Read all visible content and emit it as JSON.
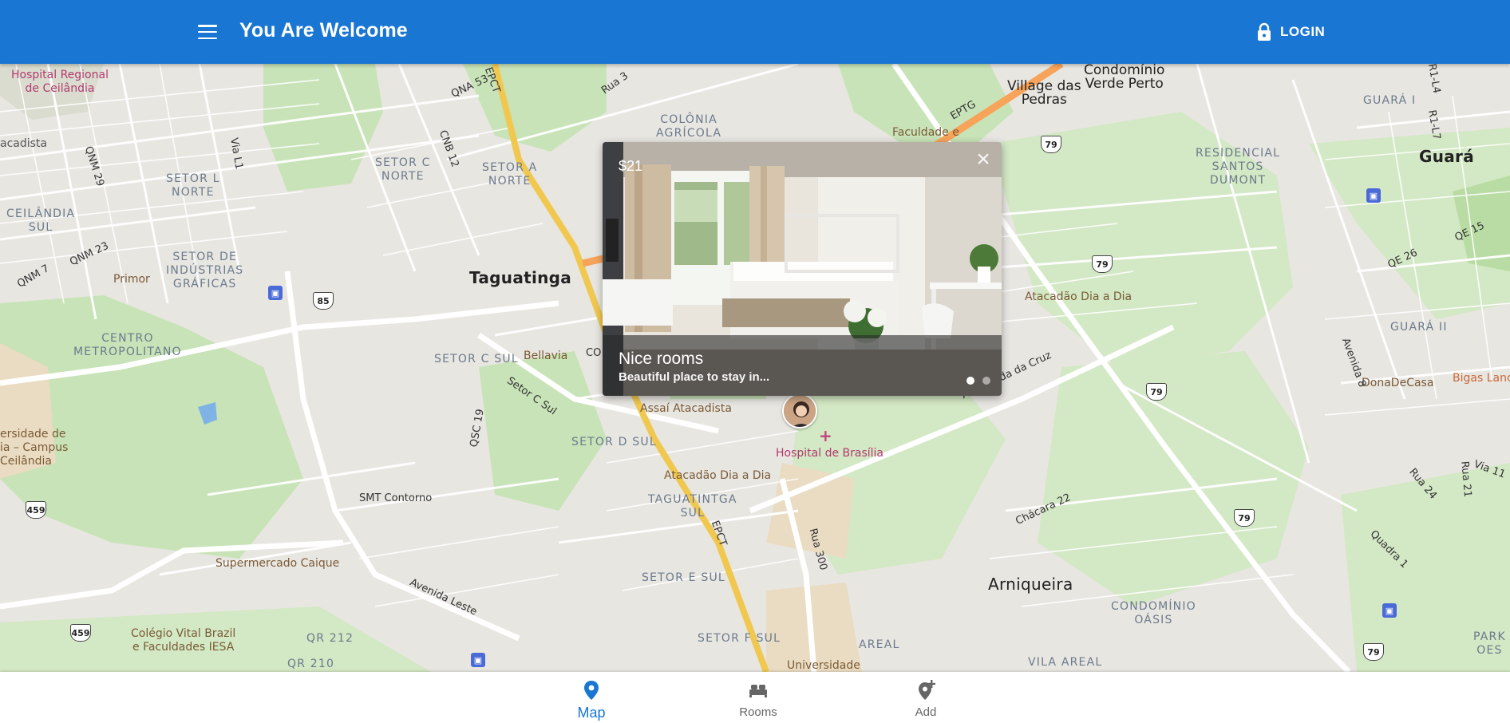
{
  "appbar": {
    "title": "You Are Welcome",
    "login_label": "LOGIN",
    "background": "#1976d2"
  },
  "map": {
    "labels": {
      "hospital_regional": "Hospital Regional\nde Ceilândia",
      "acadista": "acadista",
      "qnm29": "QNM 29",
      "setor_l_norte": "SETOR L\nNORTE",
      "ceilandia_sul": "CEILÂNDIA\nSUL",
      "qnm23": "QNM 23",
      "qnm7": "QNM 7",
      "primor": "Primor",
      "setor_industrias": "SETOR DE\nINDÚSTRIAS\nGRÁFICAS",
      "centro_metro": "CENTRO\nMETROPOLITANO",
      "campus": "ersidade de\nia – Campus\nCeilândia",
      "setor_c_norte": "SETOR C\nNORTE",
      "cnb12": "CNB 12",
      "qna53": "QNA 53",
      "setor_a_norte": "SETOR A\nNORTE",
      "rua3": "Rua 3",
      "colonia": "COLÔNIA\nAGRÍCOLA",
      "faculdade": "Faculdade e",
      "eptg": "EPTG",
      "village": "Village das\nPedras",
      "condominio_vp": "Condomínio\nVerde Perto",
      "guara_i": "GUARÁ I",
      "guara": "Guará",
      "residencial": "RESIDENCIAL\nSANTOS\nDUMONT",
      "qe15": "QE 15",
      "qe26": "QE 26",
      "guara_ii": "GUARÁ II",
      "taguatinga": "Taguatinga",
      "setor_c_sul": "SETOR C SUL",
      "bellavia": "Bellavia",
      "setor_c_sul_road": "Setor C Sul",
      "atacadao1": "Atacadão Dia a Dia",
      "assai": "Assaí Atacadista",
      "hospital_brasilia": "Hospital de Brasília",
      "setor_d_sul": "SETOR D SUL",
      "atacadao2": "Atacadão Dia a Dia",
      "taguatinga_sul": "TAGUATINTGA\nSUL",
      "qsc19": "QSC 19",
      "smt": "SMT Contorno",
      "supermercado": "Supermercado Caique",
      "colegio": "Colégio Vital Brazil\ne Faculdades IESA",
      "avenida_leste": "Avenida Leste",
      "qr212": "QR 212",
      "qr210": "QR 210",
      "setor_e_sul": "SETOR E SUL",
      "setor_f_sul": "SETOR F SUL",
      "universidade": "Universidade",
      "areal": "AREAL",
      "vila_areal": "VILA AREAL",
      "arniqueira": "Arniqueira",
      "condominio_oasis": "CONDOMÍNIO\nOÁSIS",
      "rua300": "Rua 300",
      "chacara22": "Chácara 22",
      "vereda": "Av. Vereda da Cruz",
      "donadecasa": "DonaDeCasa",
      "bigas": "Bigas Lanc",
      "avenida8": "Avenida 8",
      "rua24": "Rua 24",
      "rua21": "Rua 21",
      "via11": "Via 11",
      "quadra1": "Quadra 1",
      "park": "PARK\nOES",
      "atacadao3": "Atacadão Dia a Dia",
      "epct": "EPCT",
      "epct2": "EPCT",
      "via_l1": "Via L1",
      "r1l4": "R1-L4",
      "r1l7": "R1-L7",
      "co": "CO"
    },
    "shields": [
      "85",
      "459",
      "459",
      "79",
      "79",
      "79",
      "79",
      "79"
    ]
  },
  "popup": {
    "price": "$21",
    "title": "Nice rooms",
    "subtitle": "Beautiful place to stay in...",
    "slides": 2,
    "active_slide": 1
  },
  "bottom_nav": {
    "items": [
      {
        "label": "Map",
        "icon": "map-pin-icon",
        "active": true
      },
      {
        "label": "Rooms",
        "icon": "bed-icon",
        "active": false
      },
      {
        "label": "Add",
        "icon": "add-location-icon",
        "active": false
      }
    ],
    "active_color": "#1976d2"
  }
}
